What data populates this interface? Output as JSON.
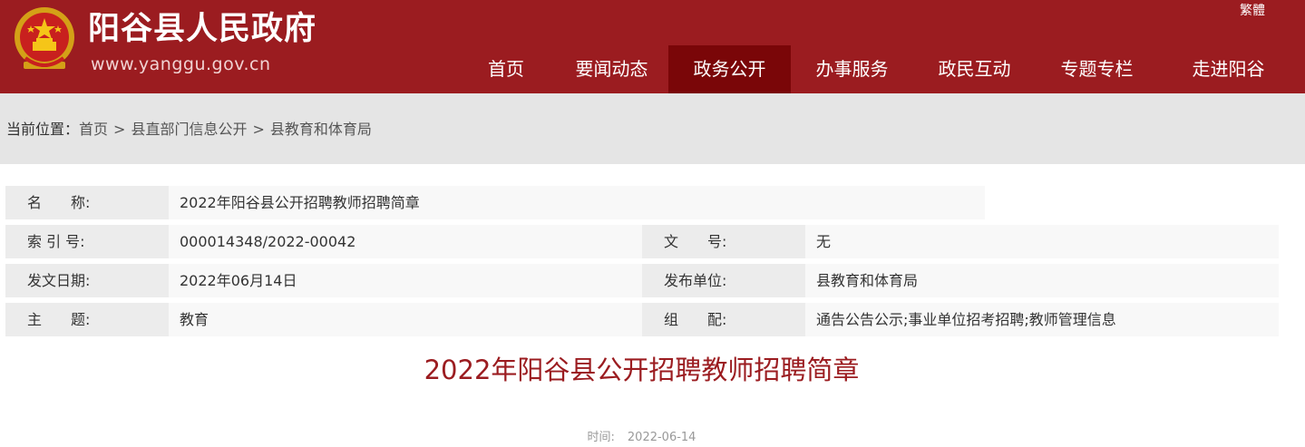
{
  "header": {
    "site_title": "阳谷县人民政府",
    "site_url": "www.yanggu.gov.cn",
    "traditional_link": "繁體",
    "colors": {
      "header_bg": "#9b1c20",
      "nav_active_bg": "#7a0608",
      "title_red": "#9b1c20"
    }
  },
  "nav": {
    "items": [
      {
        "label": "首页"
      },
      {
        "label": "要闻动态"
      },
      {
        "label": "政务公开",
        "active": true
      },
      {
        "label": "办事服务"
      },
      {
        "label": "政民互动"
      },
      {
        "label": "专题专栏"
      },
      {
        "label": "走进阳谷"
      }
    ]
  },
  "breadcrumb": {
    "label": "当前位置：",
    "items": [
      "首页",
      "县直部门信息公开",
      "县教育和体育局"
    ],
    "separator": ">"
  },
  "info": {
    "name_label": "名　　称:",
    "name_value": "2022年阳谷县公开招聘教师招聘简章",
    "index_label": "索 引 号:",
    "index_value": "000014348/2022-00042",
    "docno_label": "文　　号:",
    "docno_value": "无",
    "date_label": "发文日期:",
    "date_value": "2022年06月14日",
    "publisher_label": "发布单位:",
    "publisher_value": "县教育和体育局",
    "topic_label": "主　　题:",
    "topic_value": "教育",
    "category_label": "组　　配:",
    "category_value": "通告公告公示;事业单位招考招聘;教师管理信息"
  },
  "article": {
    "title": "2022年阳谷县公开招聘教师招聘简章",
    "time_label": "时间:",
    "time_value": "2022-06-14"
  }
}
